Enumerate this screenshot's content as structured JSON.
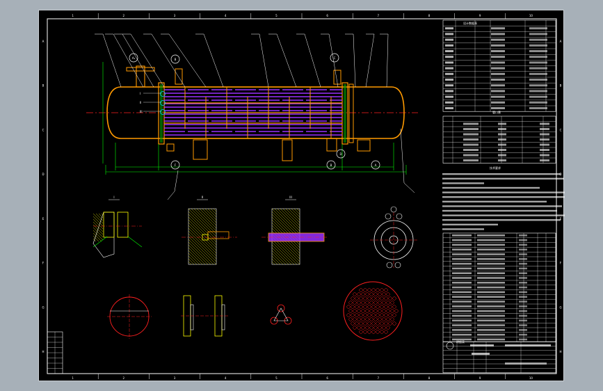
{
  "drawing": {
    "grid_columns": [
      "1",
      "2",
      "3",
      "4",
      "5",
      "6",
      "7",
      "8",
      "9",
      "10"
    ],
    "grid_rows": [
      "A",
      "B",
      "C",
      "D",
      "E",
      "F",
      "G",
      "H"
    ],
    "circle_markers": [
      "A₁",
      "B",
      "C",
      "D",
      "F",
      "B",
      "A"
    ],
    "roman_markers": [
      "I",
      "II",
      "III"
    ],
    "detail_labels": [
      "I",
      "II",
      "III"
    ],
    "notes_title": "技术要求",
    "table1_title": "设计数据表",
    "table2_title": "管口表",
    "parts_title": "明细表"
  },
  "colors": {
    "background": "#000000",
    "frame": "#ffffff",
    "shell": "#ff9a00",
    "tubes": "#9b30ff",
    "dimension": "#00ff00",
    "hatch": "#ffff00",
    "centerline": "#ff2020",
    "nozzle": "#00c8ff"
  }
}
